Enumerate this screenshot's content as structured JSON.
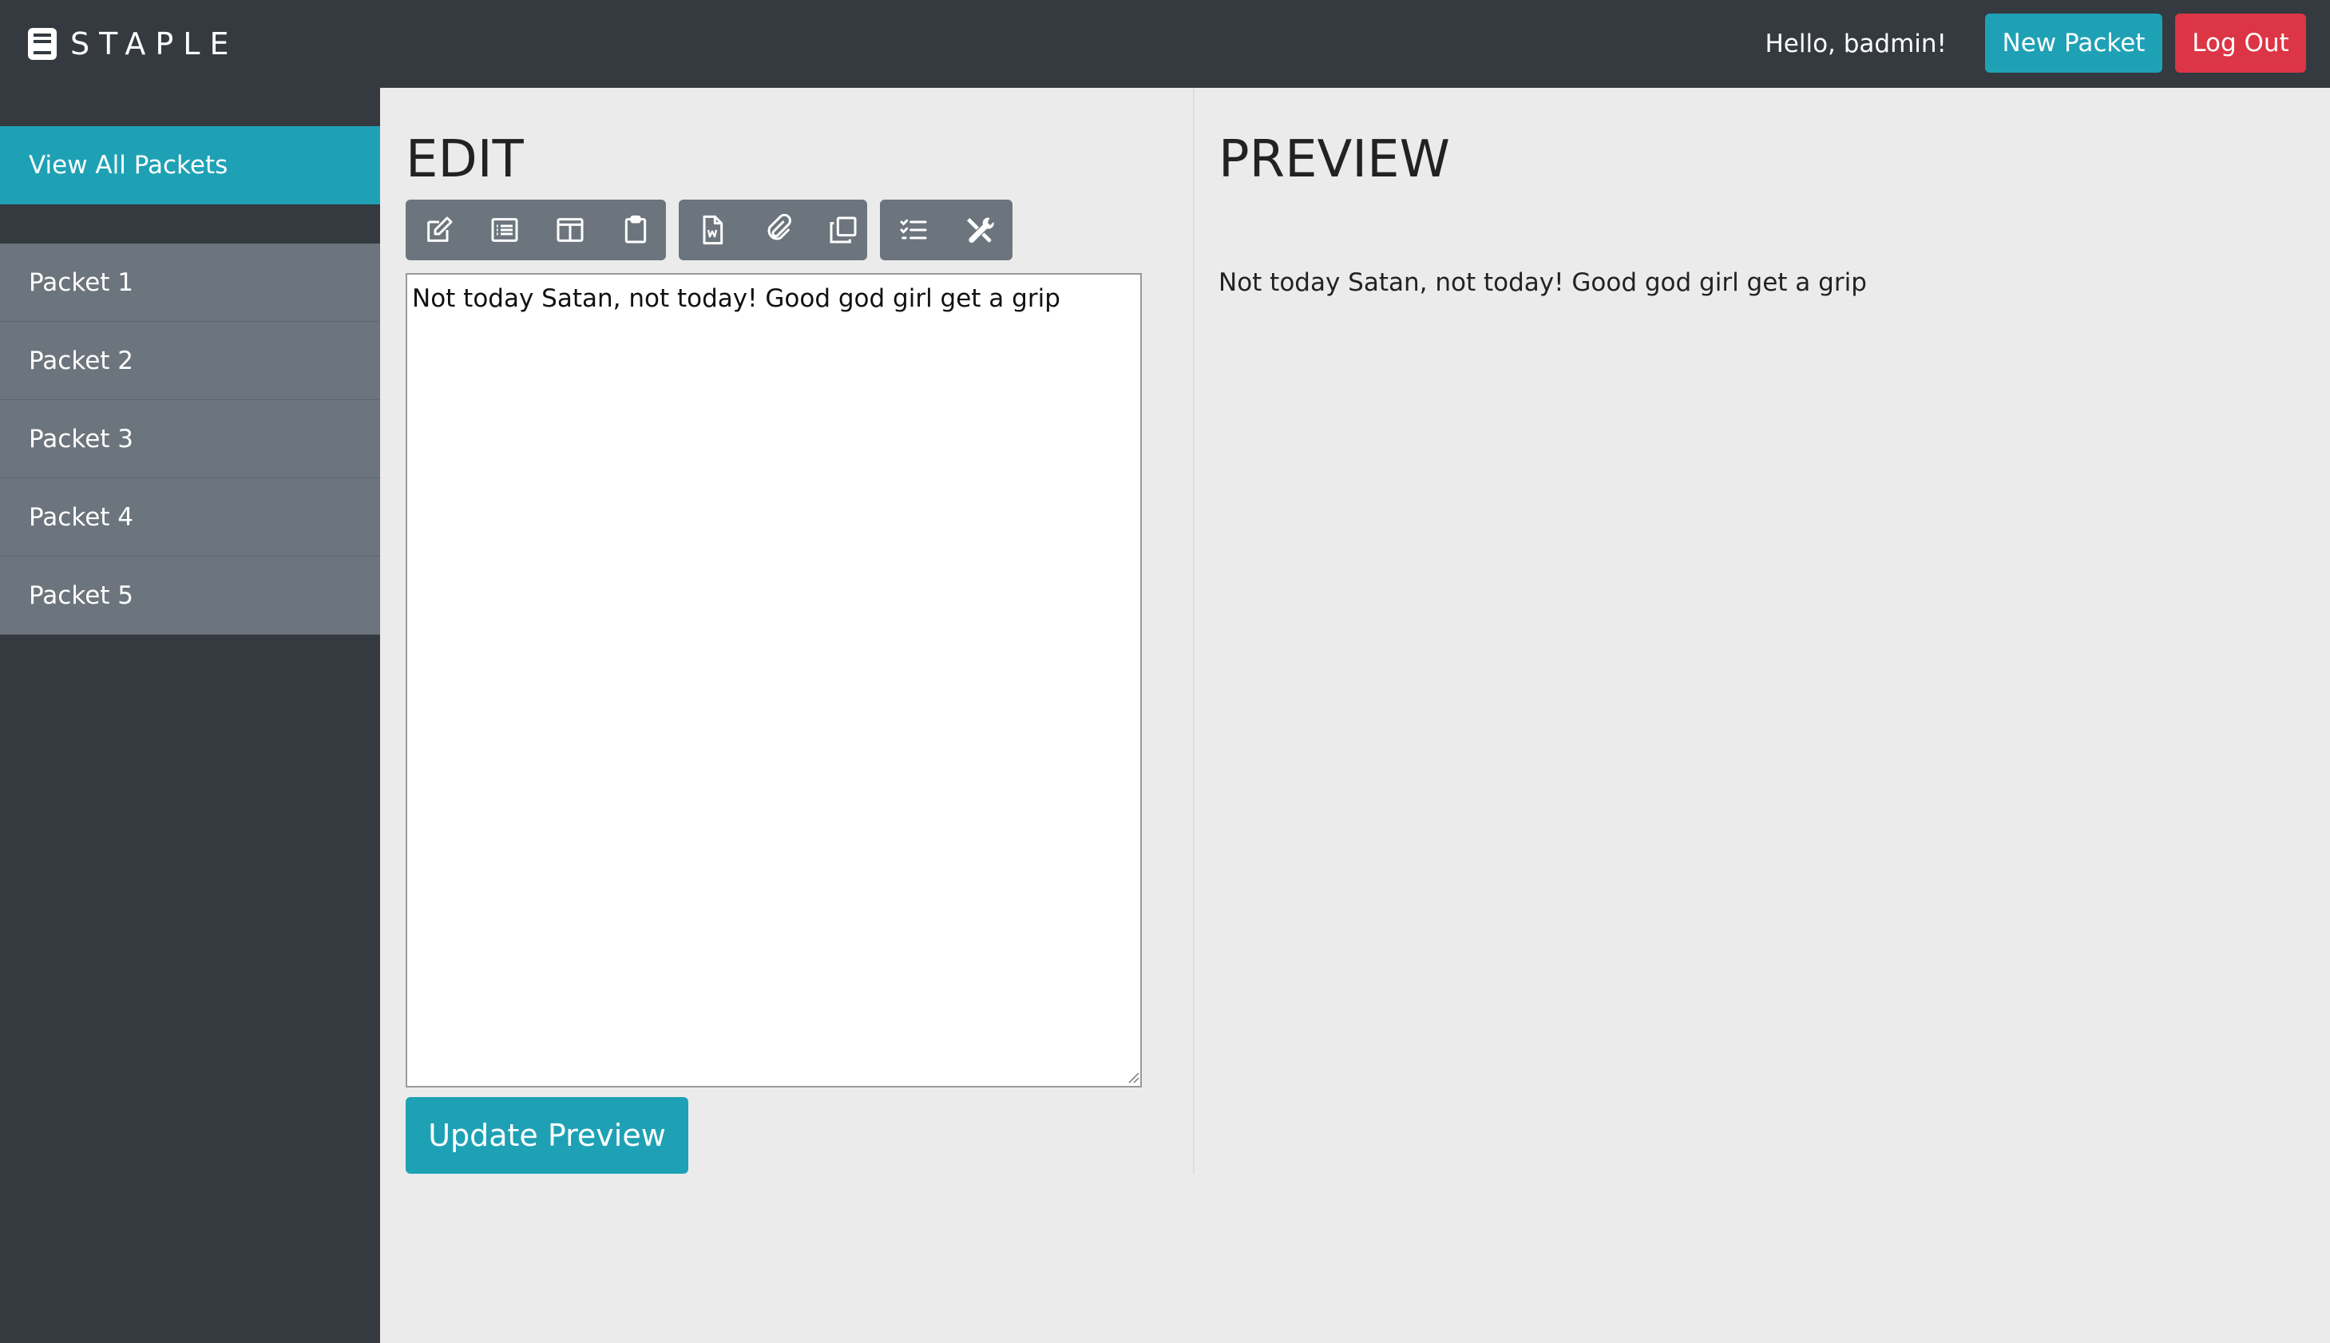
{
  "header": {
    "brand": "STAPLE",
    "brand_icon": "book-icon",
    "greeting": "Hello, badmin!",
    "new_packet_label": "New Packet",
    "logout_label": "Log Out"
  },
  "sidebar": {
    "view_all_label": "View All Packets",
    "items": [
      {
        "label": "Packet 1"
      },
      {
        "label": "Packet 2"
      },
      {
        "label": "Packet 3"
      },
      {
        "label": "Packet 4"
      },
      {
        "label": "Packet 5"
      }
    ]
  },
  "edit": {
    "title": "EDIT",
    "content": "Not today Satan, not today! Good god girl get a grip",
    "update_label": "Update Preview",
    "toolbar": {
      "groups": [
        [
          "edit-icon",
          "list-icon",
          "columns-icon",
          "clipboard-icon"
        ],
        [
          "word-doc-icon",
          "paperclip-icon",
          "copy-icon"
        ],
        [
          "checklist-icon",
          "tools-icon"
        ]
      ]
    }
  },
  "preview": {
    "title": "PREVIEW",
    "content": "Not today Satan, not today! Good god girl get a grip"
  },
  "colors": {
    "topbar": "#343a40",
    "accent": "#1fa1b5",
    "danger": "#dc3545",
    "sidebar_item": "#6c757d",
    "background": "#ebebeb"
  }
}
